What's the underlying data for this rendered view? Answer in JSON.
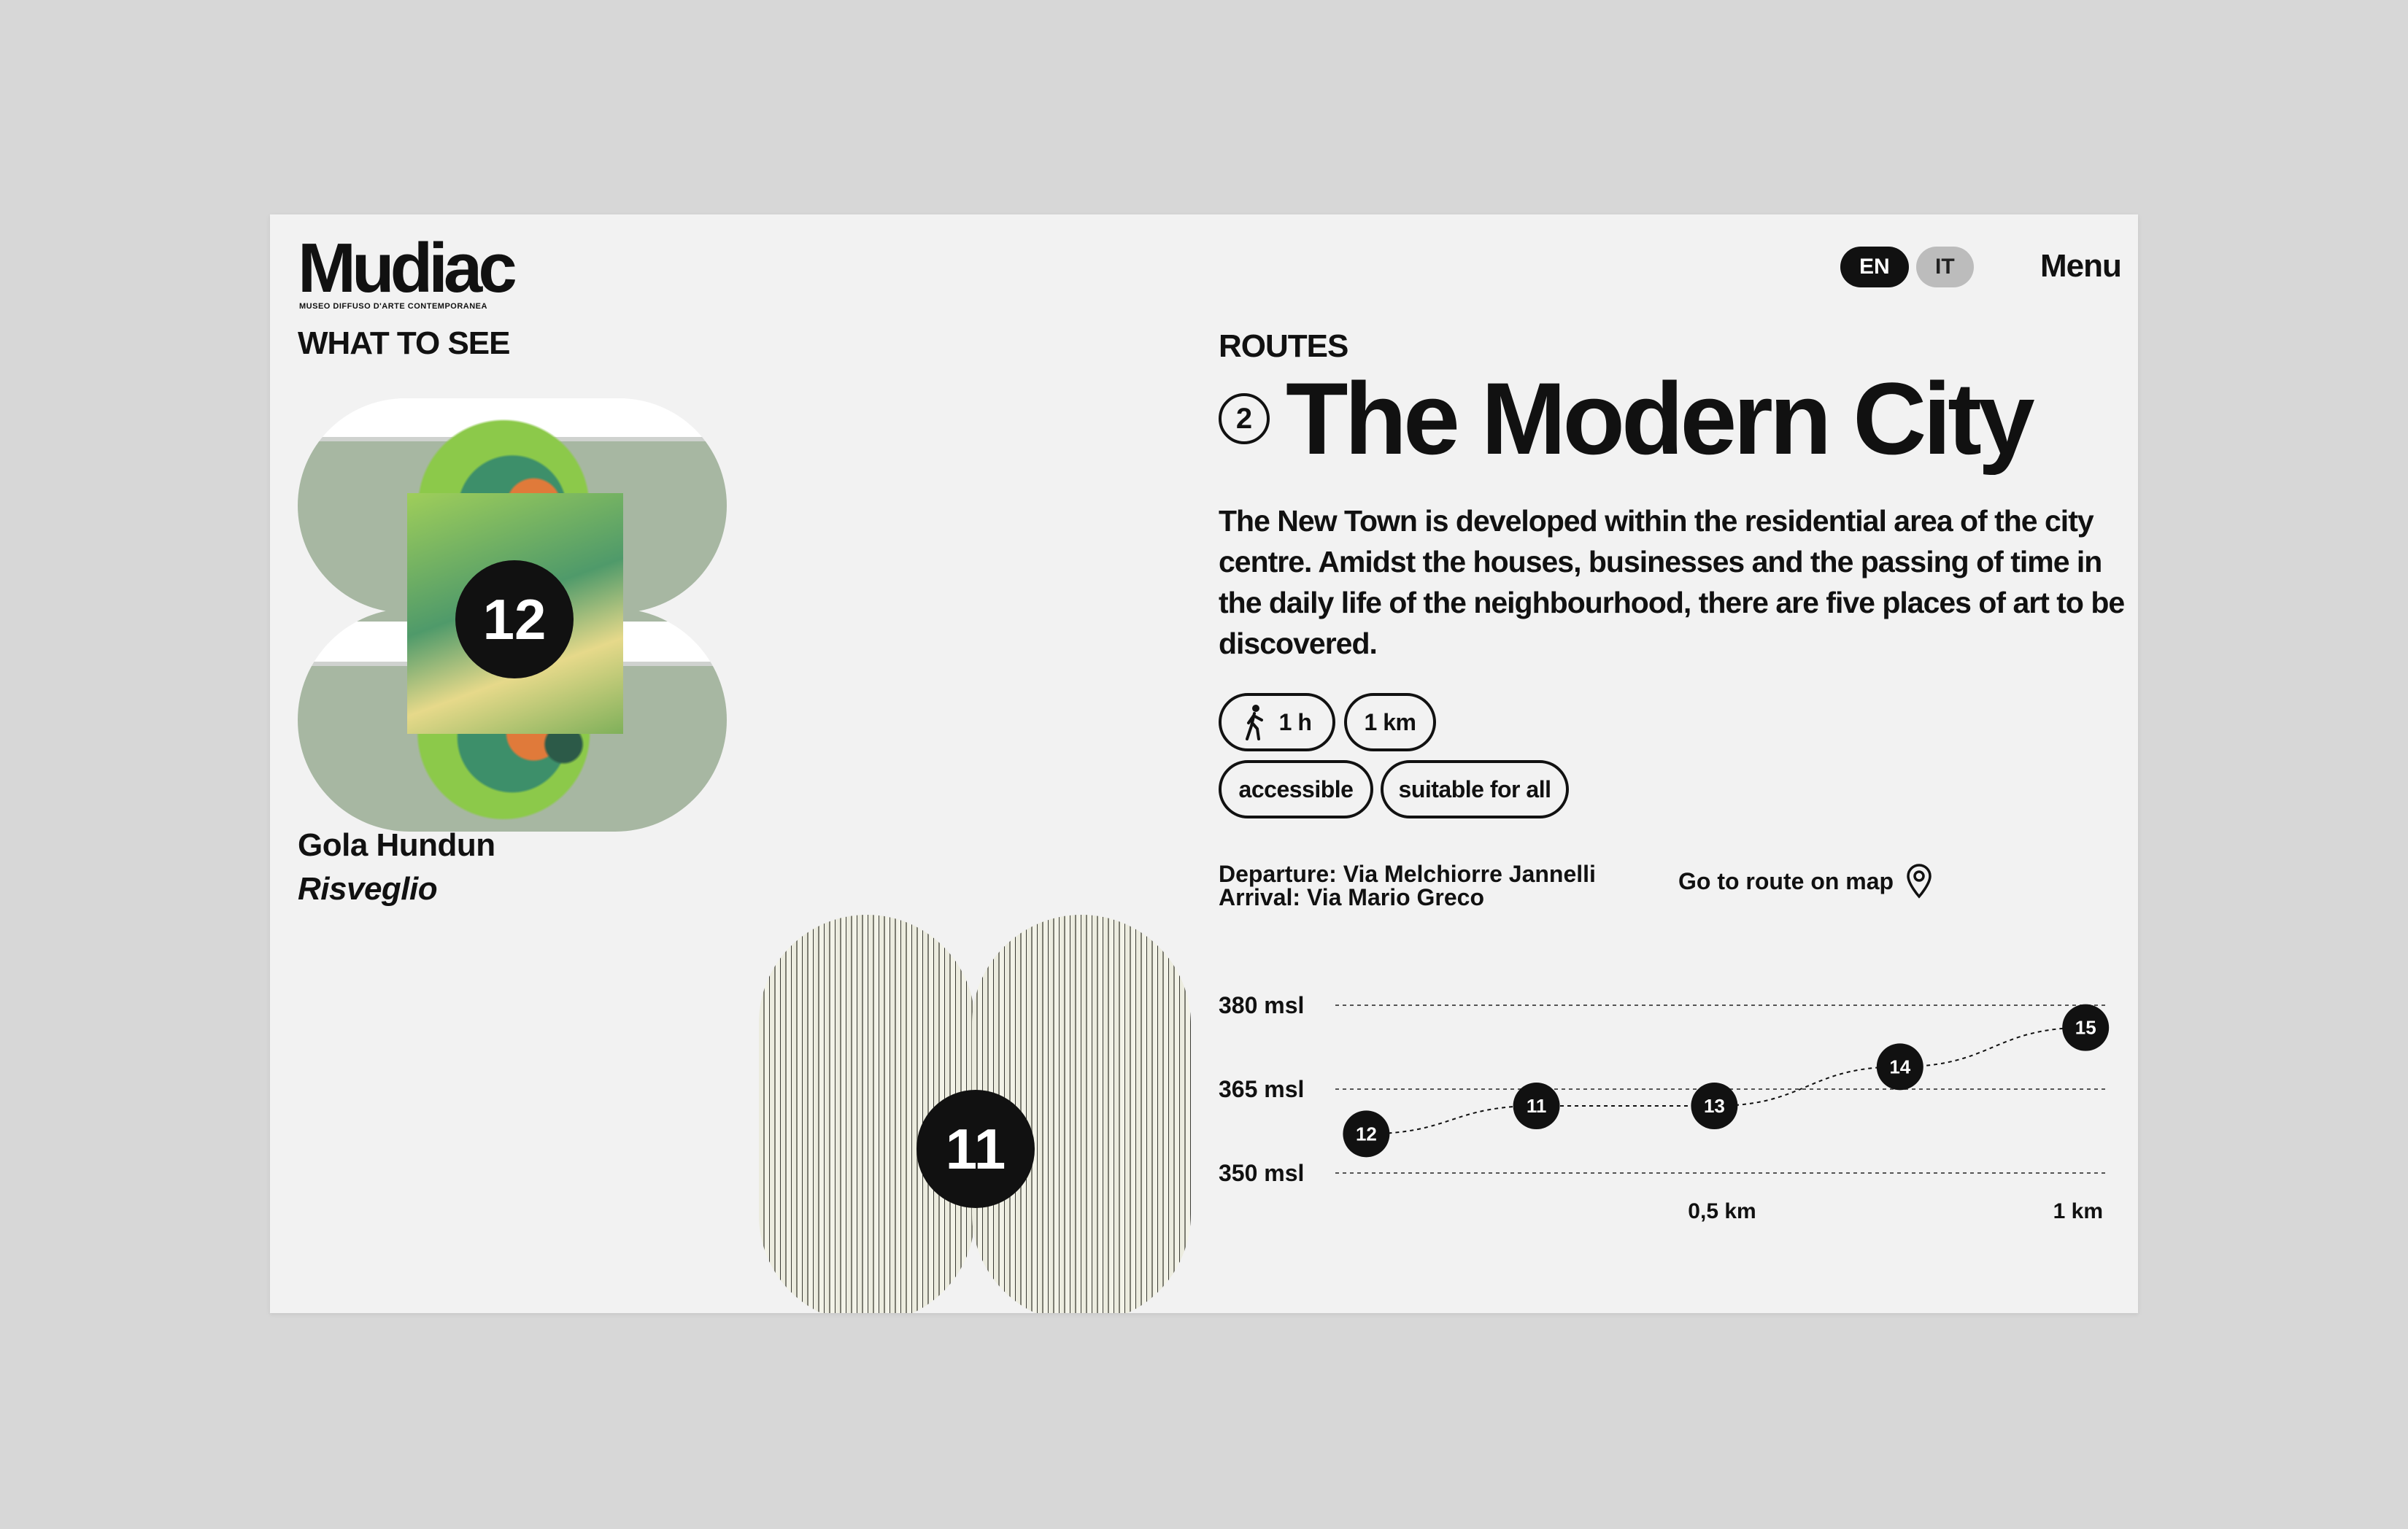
{
  "header": {
    "logo_text": "Mudiac",
    "logo_subtitle": "MUSEO DIFFUSO D'ARTE CONTEMPORANEA",
    "lang_en": "EN",
    "lang_it": "IT",
    "menu_label": "Menu"
  },
  "what_to_see": {
    "label": "WHAT TO SEE",
    "artworks": [
      {
        "number": "12",
        "artist": "Gola Hundun",
        "title": "Risveglio"
      },
      {
        "number": "11"
      }
    ]
  },
  "route": {
    "section_label": "ROUTES",
    "number": "2",
    "title": "The Modern City",
    "description": "The New Town is developed within the residential area of the city centre. Amidst the houses, businesses and the passing of time in the daily life of the neighbourhood, there are five places of art to be discovered.",
    "duration": "1 h",
    "distance": "1 km",
    "tags": [
      "accessible",
      "suitable for all"
    ],
    "departure": "Departure: Via Melchiorre Jannelli",
    "arrival": "Arrival: Via Mario Greco",
    "map_link": "Go to route on map",
    "icons": {
      "walk": "walking-person-icon",
      "map": "map-pin-icon"
    }
  },
  "chart_data": {
    "type": "line",
    "y_tick_labels": [
      "380 msl",
      "365 msl",
      "350 msl"
    ],
    "x_tick_labels": [
      "0,5 km",
      "1 km"
    ],
    "ylim": [
      350,
      380
    ],
    "xlim": [
      0,
      1
    ],
    "points": [
      {
        "label": "12",
        "x": 0.04,
        "y": 357
      },
      {
        "label": "11",
        "x": 0.26,
        "y": 362
      },
      {
        "label": "13",
        "x": 0.49,
        "y": 362
      },
      {
        "label": "14",
        "x": 0.73,
        "y": 369
      },
      {
        "label": "15",
        "x": 0.97,
        "y": 376
      }
    ]
  }
}
